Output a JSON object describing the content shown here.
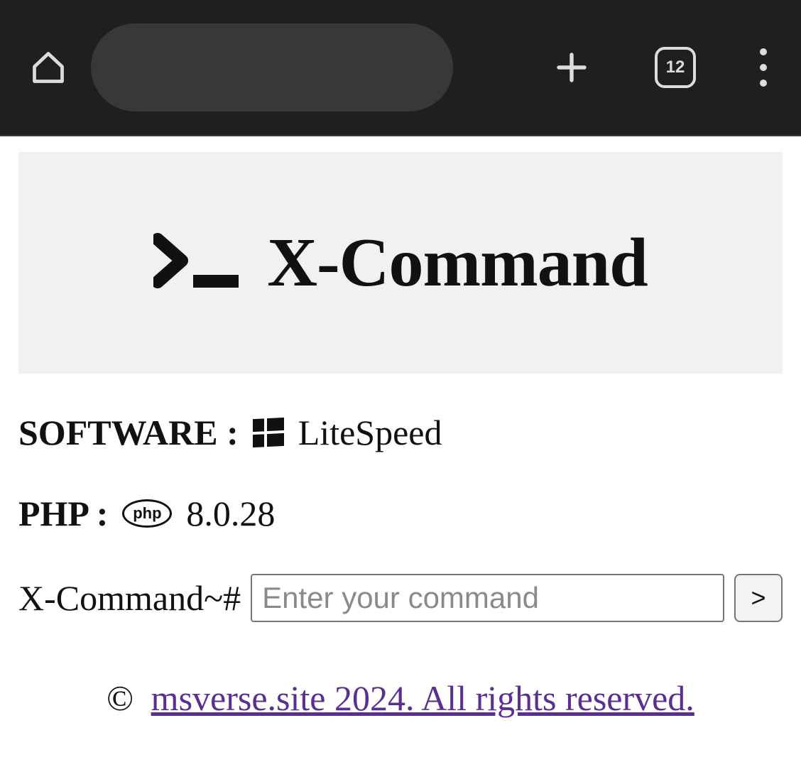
{
  "browser": {
    "tab_count": "12"
  },
  "hero": {
    "title": "X-Command"
  },
  "info": {
    "software_label": "SOFTWARE :",
    "software_value": "LiteSpeed",
    "php_label": "PHP :",
    "php_badge": "php",
    "php_value": "8.0.28"
  },
  "command": {
    "prompt": "X-Command~#",
    "placeholder": "Enter your command",
    "submit_label": ">"
  },
  "footer": {
    "copyright_symbol": "©",
    "link_text": "msverse.site 2024. All rights reserved."
  }
}
